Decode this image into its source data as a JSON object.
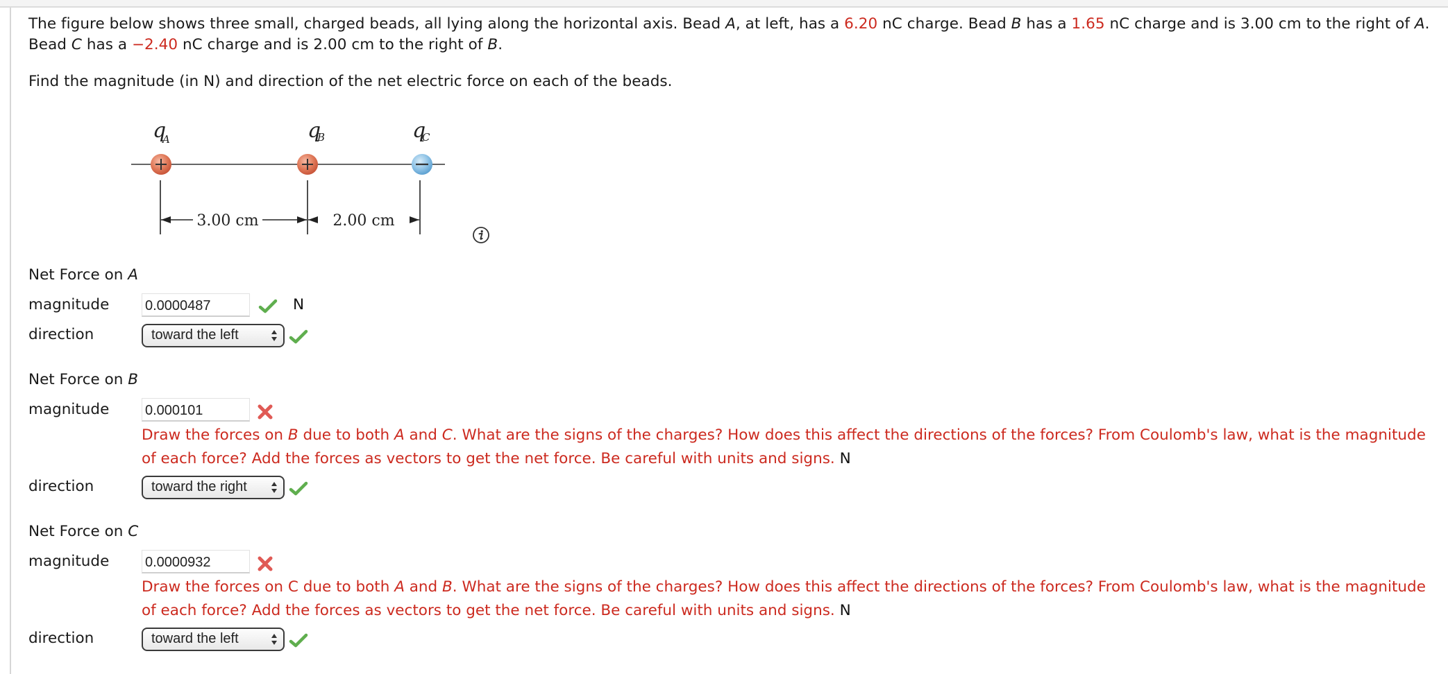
{
  "problem": {
    "intro": {
      "s1": "The figure below shows three small, charged beads, all lying along the horizontal axis. Bead ",
      "beadA": "A",
      "s2": ", at left, has a ",
      "qA": "6.20",
      "s3": " nC charge. Bead ",
      "beadB": "B",
      "s4": " has a ",
      "qB": "1.65",
      "s5": " nC charge and is 3.00 cm to the right of ",
      "beadA2": "A",
      "s6": ". Bead ",
      "beadC": "C",
      "s7": " has a ",
      "qC": "−2.40",
      "s8": " nC charge and is 2.00 cm to the right of ",
      "beadB2": "B",
      "s9": "."
    },
    "question": "Find the magnitude (in N) and direction of the net electric force on each of the beads."
  },
  "figure": {
    "labels": {
      "qA": "q",
      "qA_sub": "A",
      "qB": "q",
      "qB_sub": "B",
      "qC": "q",
      "qC_sub": "C"
    },
    "signs": {
      "A": "+",
      "B": "+",
      "C": "−"
    },
    "dist_AB": "3.00 cm",
    "dist_BC": "2.00 cm",
    "colors": {
      "positive": "#e07a5a",
      "negative": "#8fc3e6"
    },
    "info_icon": "info-icon"
  },
  "sections": [
    {
      "title_prefix": "Net Force on ",
      "title_var": "A",
      "magnitude_label": "magnitude",
      "magnitude_value": "0.0000487",
      "magnitude_status": "correct",
      "unit": "N",
      "direction_label": "direction",
      "direction_value": "toward the left",
      "direction_status": "correct"
    },
    {
      "title_prefix": "Net Force on ",
      "title_var": "B",
      "magnitude_label": "magnitude",
      "magnitude_value": "0.000101",
      "magnitude_status": "incorrect",
      "hint": {
        "t1": "Draw the forces on ",
        "v1": "B",
        "t2": " due to both ",
        "v2": "A",
        "t3": " and ",
        "v3": "C",
        "t4": ". What are the signs of the charges? How does this affect the directions of the forces? From Coulomb's law, what is the magnitude of each force? Add the forces as vectors to get the net force. Be careful with units and signs.",
        "unit": "N"
      },
      "direction_label": "direction",
      "direction_value": "toward the right",
      "direction_status": "correct"
    },
    {
      "title_prefix": "Net Force on ",
      "title_var": "C",
      "magnitude_label": "magnitude",
      "magnitude_value": "0.0000932",
      "magnitude_status": "incorrect",
      "hint": {
        "t1": "Draw the forces on C due to both ",
        "v2": "A",
        "t3": " and ",
        "v3": "B",
        "t4": ". What are the signs of the charges? How does this affect the directions of the forces? From Coulomb's law, what is the magnitude of each force? Add the forces as vectors to get the net force. Be careful with units and signs.",
        "unit": "N"
      },
      "direction_label": "direction",
      "direction_value": "toward the left",
      "direction_status": "correct"
    }
  ],
  "status_colors": {
    "correct": "#5fae4e",
    "incorrect": "#e05a55",
    "hint_text": "#cc2a1f",
    "highlight_value": "#cc2a1f"
  }
}
